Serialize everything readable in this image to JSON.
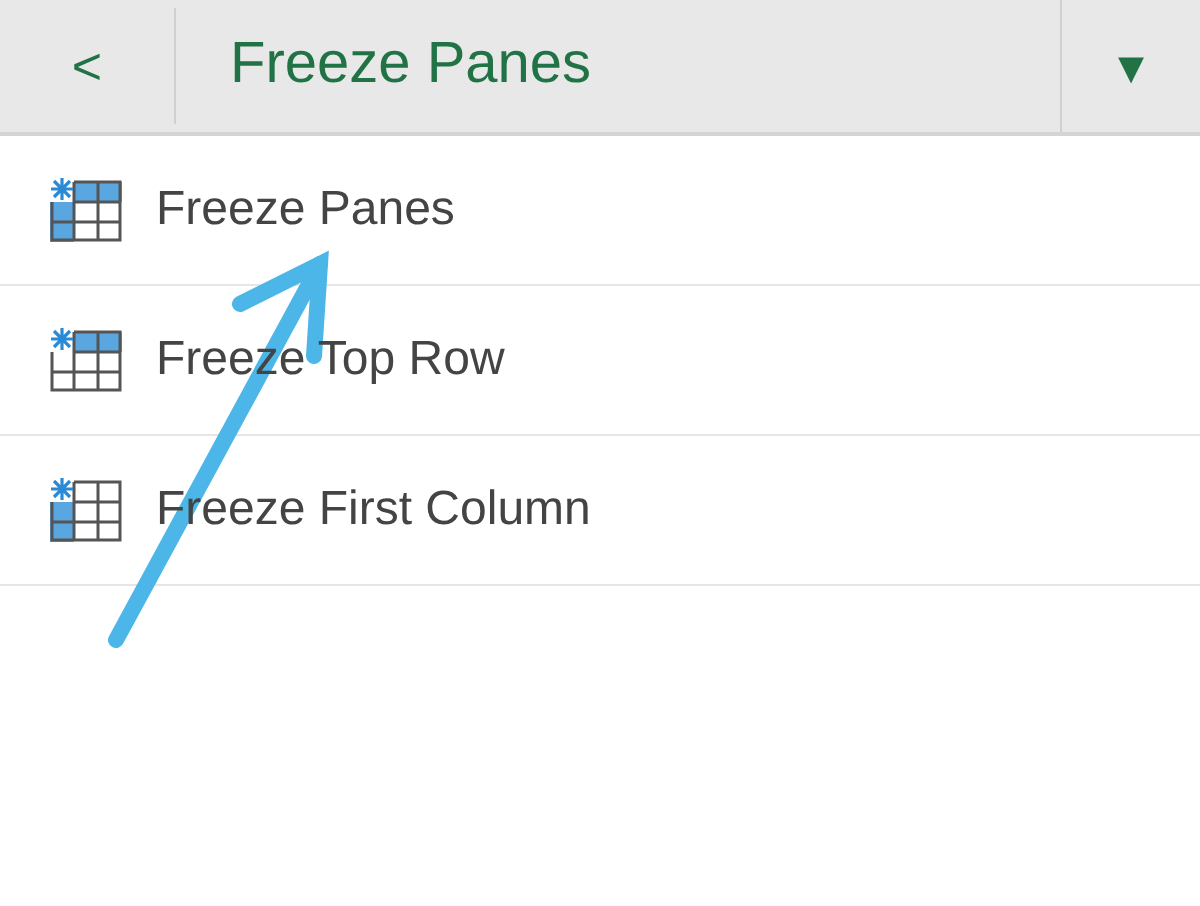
{
  "header": {
    "back": "<",
    "title": "Freeze Panes",
    "menu": "▾"
  },
  "items": [
    {
      "label": "Freeze Panes",
      "kind": "panes"
    },
    {
      "label": "Freeze Top Row",
      "kind": "top_row"
    },
    {
      "label": "Freeze First Column",
      "kind": "first_column"
    }
  ]
}
